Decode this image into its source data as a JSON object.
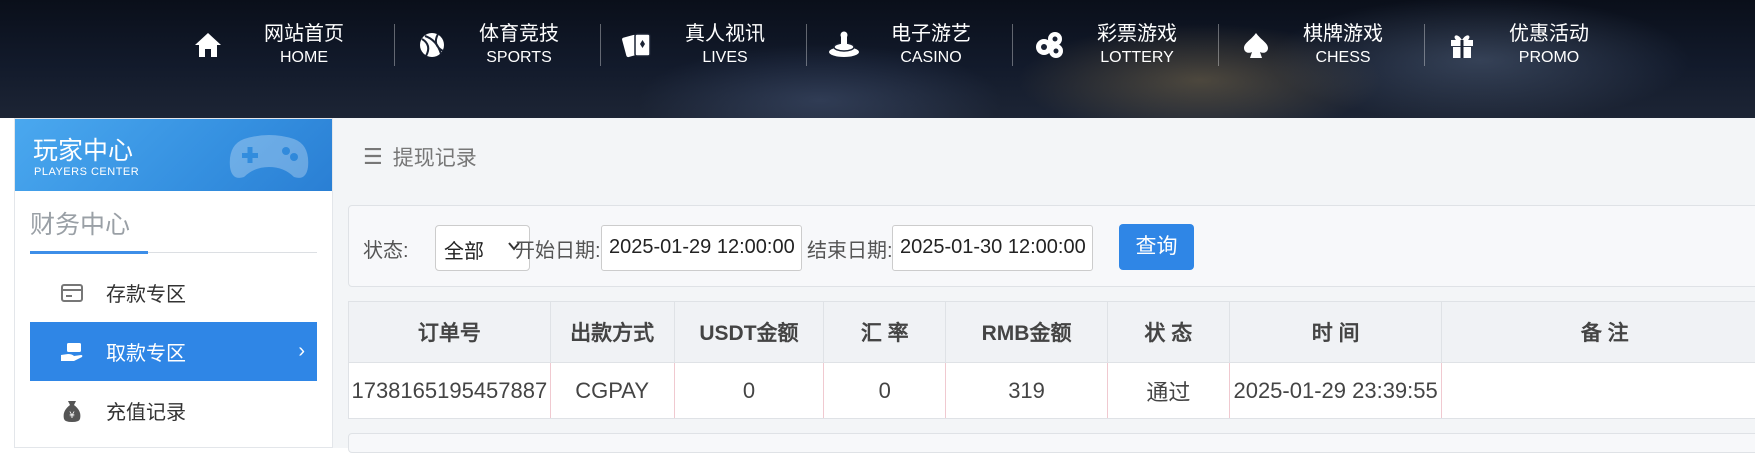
{
  "nav": [
    {
      "cn": "网站首页",
      "en": "HOME",
      "icon": "home-icon"
    },
    {
      "cn": "体育竞技",
      "en": "SPORTS",
      "icon": "ball-icon"
    },
    {
      "cn": "真人视讯",
      "en": "LIVES",
      "icon": "cards-icon"
    },
    {
      "cn": "电子游艺",
      "en": "CASINO",
      "icon": "slot-icon"
    },
    {
      "cn": "彩票游戏",
      "en": "LOTTERY",
      "icon": "lottery-balls-icon"
    },
    {
      "cn": "棋牌游戏",
      "en": "CHESS",
      "icon": "spade-icon"
    },
    {
      "cn": "优惠活动",
      "en": "PROMO",
      "icon": "gift-icon"
    }
  ],
  "sidebar": {
    "header_cn": "玩家中心",
    "header_en": "PLAYERS CENTER",
    "section_title": "财务中心",
    "items": [
      {
        "label": "存款专区",
        "icon": "deposit-icon",
        "active": false
      },
      {
        "label": "取款专区",
        "icon": "withdraw-hand-icon",
        "active": true
      },
      {
        "label": "充值记录",
        "icon": "money-bag-icon",
        "active": false
      }
    ]
  },
  "main": {
    "breadcrumb": "提现记录",
    "filter": {
      "status_label": "状态:",
      "status_value": "全部",
      "start_label": "开始日期:",
      "start_value": "2025-01-29 12:00:00",
      "end_label": "结束日期:",
      "end_value": "2025-01-30 12:00:00",
      "query_button": "查询"
    },
    "table": {
      "headers": [
        "订单号",
        "出款方式",
        "USDT金额",
        "汇 率",
        "RMB金额",
        "状 态",
        "时 间",
        "备 注"
      ],
      "rows": [
        [
          "1738165195457887",
          "CGPAY",
          "0",
          "0",
          "319",
          "通过",
          "2025-01-29 23:39:55",
          ""
        ]
      ]
    }
  },
  "colors": {
    "accent": "#2f86e6",
    "sidebar_header": "#3a95e4",
    "nav_bg": "#0f1626"
  }
}
